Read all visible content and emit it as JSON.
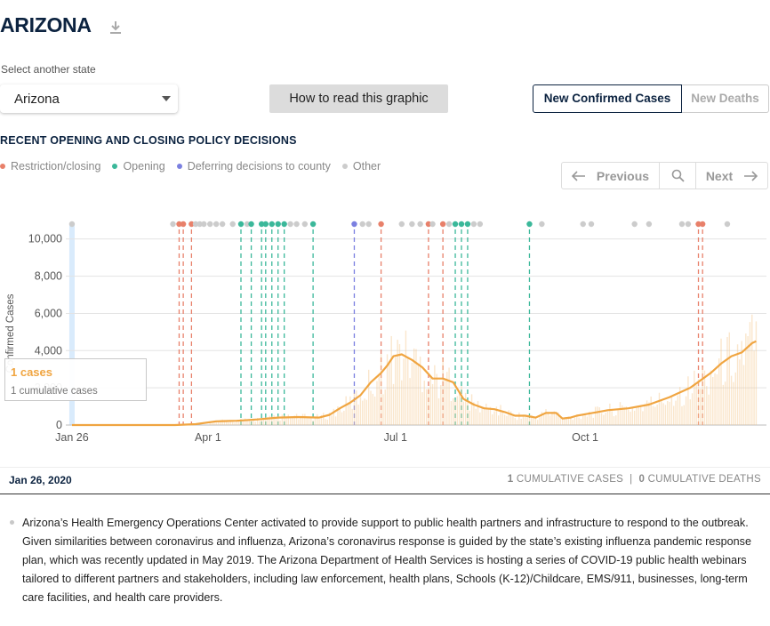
{
  "header": {
    "title": "ARIZONA",
    "download_icon": "download-icon"
  },
  "state_select": {
    "label": "Select another state",
    "value": "Arizona"
  },
  "howto_button": {
    "label": "How to read this graphic"
  },
  "toggle": {
    "active": "New Confirmed Cases",
    "inactive": "New Deaths"
  },
  "policy": {
    "title": "RECENT OPENING AND CLOSING POLICY DECISIONS",
    "legend": [
      {
        "label": "Restriction/closing",
        "color": "#e8806a"
      },
      {
        "label": "Opening",
        "color": "#3bb89a"
      },
      {
        "label": "Deferring decisions to county",
        "color": "#7b80e0"
      },
      {
        "label": "Other",
        "color": "#cccccc"
      }
    ]
  },
  "pager": {
    "previous": "Previous",
    "next": "Next",
    "search_icon": "search-icon"
  },
  "chart_data": {
    "type": "line",
    "ylabel": "Confirmed Cases",
    "y_ticks": [
      "0",
      "2,000",
      "4,000",
      "6,000",
      "8,000",
      "10,000"
    ],
    "ylim": [
      0,
      10800
    ],
    "x_ticks": [
      "Jan 26",
      "Apr 1",
      "Jul 1",
      "Oct 1"
    ],
    "xlim_days": [
      -3,
      337
    ],
    "x_tick_days": [
      0,
      66,
      157,
      249
    ],
    "series": [
      {
        "name": "7-day average",
        "color": "#f0a541",
        "x_days": [
          0,
          50,
          60,
          70,
          80,
          90,
          100,
          110,
          120,
          125,
          130,
          135,
          140,
          145,
          150,
          153,
          156,
          160,
          165,
          170,
          175,
          180,
          185,
          190,
          195,
          200,
          205,
          210,
          215,
          220,
          225,
          230,
          235,
          238,
          242,
          245,
          250,
          255,
          260,
          270,
          280,
          290,
          300,
          305,
          310,
          315,
          320,
          325,
          330,
          332
        ],
        "values": [
          0,
          0,
          50,
          200,
          230,
          300,
          400,
          430,
          400,
          550,
          900,
          1200,
          1600,
          2300,
          2800,
          3200,
          3700,
          3800,
          3500,
          3100,
          2500,
          2500,
          2300,
          1400,
          1100,
          900,
          850,
          700,
          500,
          500,
          400,
          650,
          650,
          350,
          400,
          500,
          600,
          700,
          800,
          900,
          1100,
          1500,
          2000,
          2400,
          2800,
          3300,
          3700,
          3900,
          4400,
          4500
        ]
      }
    ],
    "policy_events": [
      {
        "day": 0,
        "type": "other"
      },
      {
        "day": 49,
        "type": "other"
      },
      {
        "day": 52,
        "type": "restriction"
      },
      {
        "day": 54,
        "type": "restriction"
      },
      {
        "day": 58,
        "type": "restriction"
      },
      {
        "day": 60,
        "type": "other"
      },
      {
        "day": 62,
        "type": "other"
      },
      {
        "day": 64,
        "type": "other"
      },
      {
        "day": 67,
        "type": "other"
      },
      {
        "day": 70,
        "type": "other"
      },
      {
        "day": 73,
        "type": "other"
      },
      {
        "day": 78,
        "type": "other"
      },
      {
        "day": 82,
        "type": "opening"
      },
      {
        "day": 85,
        "type": "other"
      },
      {
        "day": 87,
        "type": "opening"
      },
      {
        "day": 92,
        "type": "opening"
      },
      {
        "day": 94,
        "type": "opening"
      },
      {
        "day": 97,
        "type": "opening"
      },
      {
        "day": 100,
        "type": "opening"
      },
      {
        "day": 103,
        "type": "opening"
      },
      {
        "day": 106,
        "type": "other"
      },
      {
        "day": 109,
        "type": "other"
      },
      {
        "day": 113,
        "type": "other"
      },
      {
        "day": 117,
        "type": "opening"
      },
      {
        "day": 137,
        "type": "county"
      },
      {
        "day": 141,
        "type": "other"
      },
      {
        "day": 144,
        "type": "other"
      },
      {
        "day": 150,
        "type": "restriction"
      },
      {
        "day": 160,
        "type": "other"
      },
      {
        "day": 165,
        "type": "other"
      },
      {
        "day": 169,
        "type": "other"
      },
      {
        "day": 173,
        "type": "restriction"
      },
      {
        "day": 175,
        "type": "other"
      },
      {
        "day": 180,
        "type": "restriction"
      },
      {
        "day": 183,
        "type": "other"
      },
      {
        "day": 186,
        "type": "opening"
      },
      {
        "day": 189,
        "type": "opening"
      },
      {
        "day": 192,
        "type": "opening"
      },
      {
        "day": 195,
        "type": "other"
      },
      {
        "day": 198,
        "type": "other"
      },
      {
        "day": 222,
        "type": "opening"
      },
      {
        "day": 228,
        "type": "other"
      },
      {
        "day": 248,
        "type": "other"
      },
      {
        "day": 252,
        "type": "other"
      },
      {
        "day": 273,
        "type": "other"
      },
      {
        "day": 280,
        "type": "other"
      },
      {
        "day": 296,
        "type": "other"
      },
      {
        "day": 299,
        "type": "other"
      },
      {
        "day": 304,
        "type": "restriction"
      },
      {
        "day": 306,
        "type": "restriction"
      },
      {
        "day": 318,
        "type": "other"
      }
    ],
    "selected_day": 0
  },
  "tooltip": {
    "cases": "1 cases",
    "cumulative": "1 cumulative cases"
  },
  "datebar": {
    "date": "Jan 26, 2020",
    "cum_cases_num": "1",
    "cum_cases_label": "CUMULATIVE CASES",
    "sep": "|",
    "cum_deaths_num": "0",
    "cum_deaths_label": "CUMULATIVE DEATHS"
  },
  "note": {
    "text": "Arizona’s Health Emergency Operations Center activated to provide support to public health partners and infrastructure to respond to the outbreak. Given similarities between coronavirus and influenza, Arizona’s coronavirus response is guided by the state’s existing influenza pandemic response plan, which was recently updated in May 2019. The Arizona Department of Health Services is hosting a series of COVID-19 public health webinars tailored to different partners and stakeholders, including law enforcement, health plans, Schools (K-12)/Childcare, EMS/911, businesses, long-term care facilities, and health care providers."
  }
}
